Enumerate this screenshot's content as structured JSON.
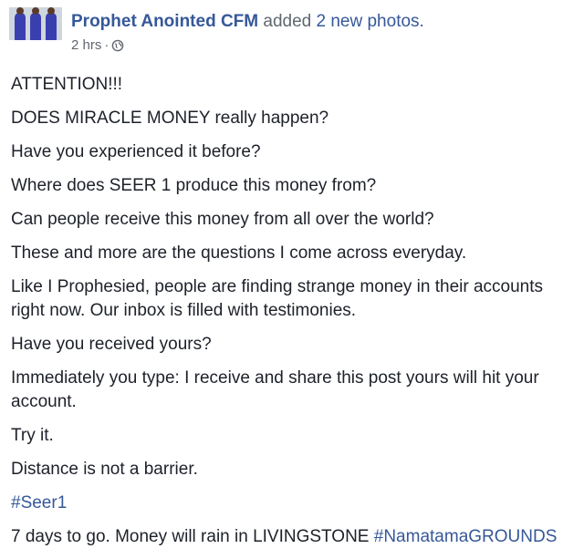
{
  "post": {
    "author": "Prophet Anointed CFM",
    "action_text": "added",
    "photos_link": "2 new photos.",
    "time": "2 hrs",
    "separator": "·",
    "privacy_icon": "globe-icon",
    "paragraphs": [
      "ATTENTION!!!",
      "DOES MIRACLE MONEY really happen?",
      "Have you experienced it before?",
      "Where does SEER 1 produce this money from?",
      "Can people receive this money from all over the world?",
      "These and more are the questions I come across everyday.",
      "Like I Prophesied, people are finding strange money in their accounts right now. Our inbox is filled with testimonies.",
      "Have you received yours?",
      "Immediately you type: I receive and share this post yours will hit your account.",
      "Try it.",
      "Distance is not a barrier."
    ],
    "hashtag_seer": "#Seer1",
    "last_line_text": "7 days to go. Money will rain in LIVINGSTONE ",
    "hashtag_grounds": "#NamatamaGROUNDS"
  },
  "colors": {
    "link": "#365899",
    "secondary_text": "#616770",
    "body_text": "#1d2129"
  }
}
